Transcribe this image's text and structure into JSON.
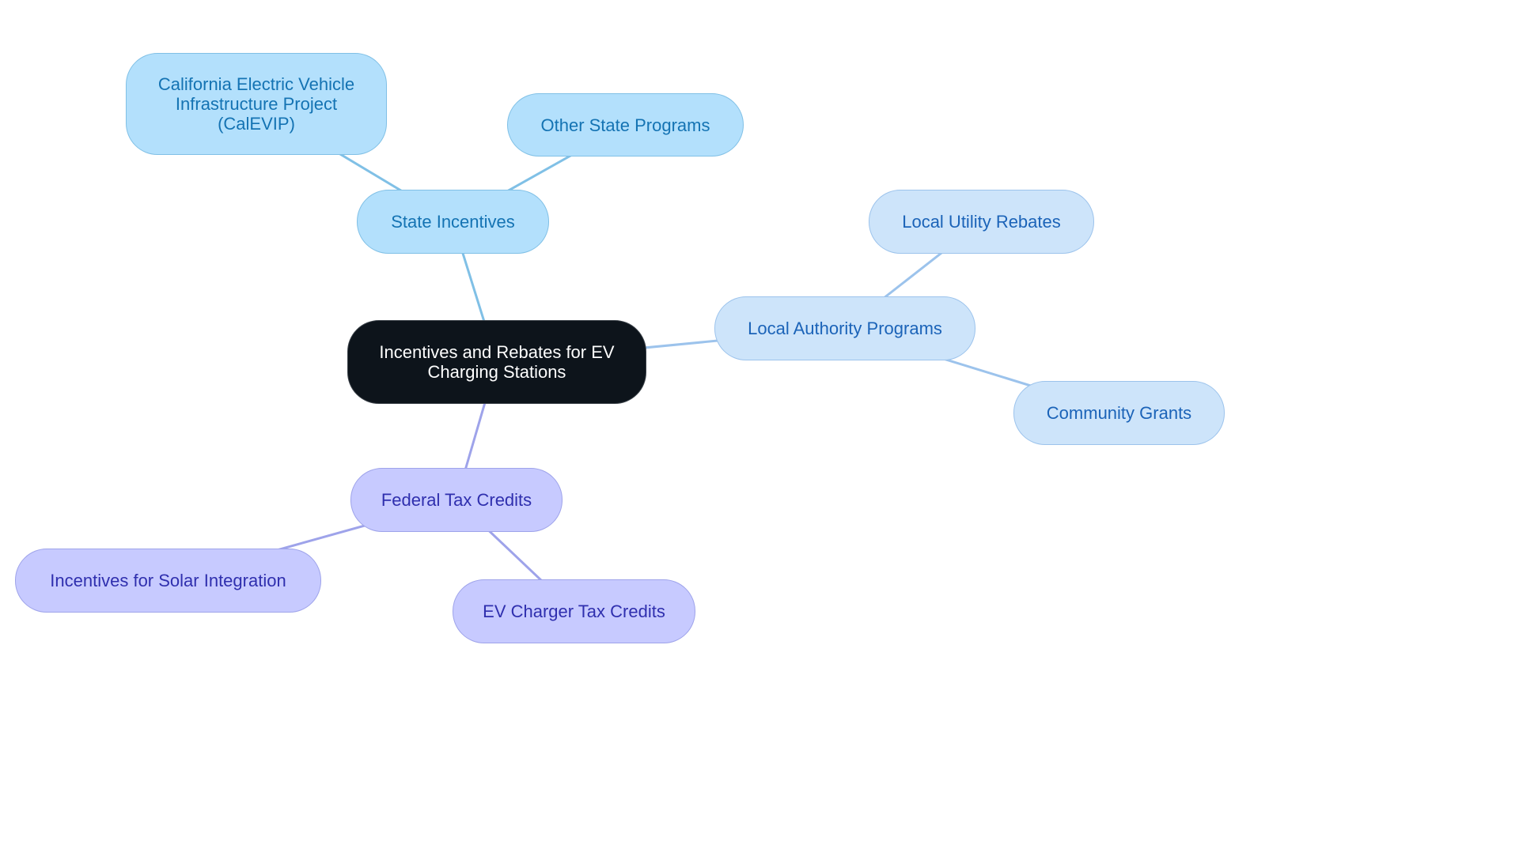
{
  "diagram": {
    "type": "mind-map",
    "colors": {
      "background": "#ffffff",
      "root_fill": "#0d141b",
      "root_text": "#ffffff",
      "state_fill": "#b3e0fc",
      "state_stroke": "#80c0e6",
      "state_text": "#1473b3",
      "local_fill": "#cde4fa",
      "local_stroke": "#9cc3ec",
      "local_text": "#1b63b8",
      "federal_fill": "#c7caff",
      "federal_stroke": "#9ea3ea",
      "federal_text": "#2f2fae"
    },
    "root": {
      "id": "root",
      "label": "Incentives and Rebates for EV Charging Stations"
    },
    "branches": [
      {
        "id": "state",
        "label": "State Incentives",
        "group": "state",
        "children": [
          {
            "id": "calevip",
            "label": "California Electric Vehicle Infrastructure Project (CalEVIP)",
            "group": "state"
          },
          {
            "id": "other-state",
            "label": "Other State Programs",
            "group": "state"
          }
        ]
      },
      {
        "id": "local",
        "label": "Local Authority Programs",
        "group": "local",
        "children": [
          {
            "id": "utility",
            "label": "Local Utility Rebates",
            "group": "local"
          },
          {
            "id": "community",
            "label": "Community Grants",
            "group": "local"
          }
        ]
      },
      {
        "id": "federal",
        "label": "Federal Tax Credits",
        "group": "federal",
        "children": [
          {
            "id": "solar",
            "label": "Incentives for Solar Integration",
            "group": "federal"
          },
          {
            "id": "ev-charger",
            "label": "EV Charger Tax Credits",
            "group": "federal"
          }
        ]
      }
    ]
  }
}
